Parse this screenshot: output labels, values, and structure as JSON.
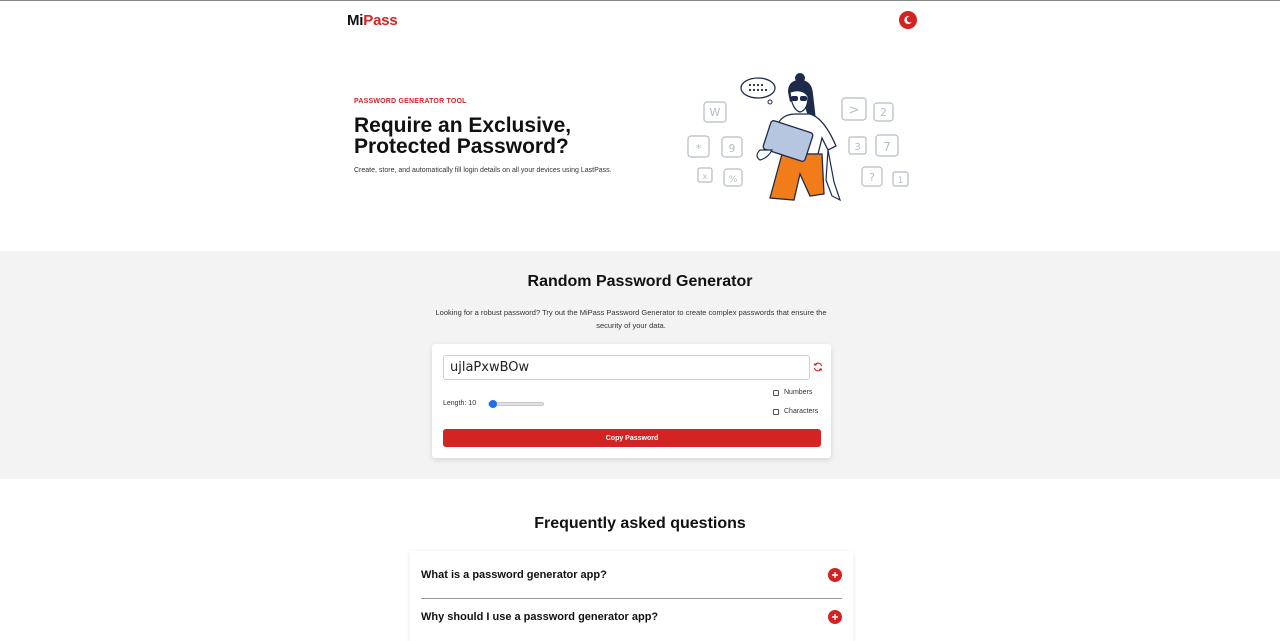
{
  "brand": {
    "mi": "Mi",
    "pass": "Pass",
    "accent": "#d42323"
  },
  "hero": {
    "eyebrow": "PASSWORD GENERATOR TOOL",
    "title_line1": "Require an Exclusive,",
    "title_line2": "Protected Password?",
    "subtitle": "Create, store, and automatically fill login details on all your devices using LastPass.",
    "illustration_keys": [
      "W",
      "*",
      "9",
      "x",
      "%",
      ">",
      "2",
      "3",
      "7",
      "?",
      "1"
    ]
  },
  "generator": {
    "title": "Random Password Generator",
    "description": "Looking for a robust password? Try out the MiPass Password Generator to create complex passwords that ensure the security of your data.",
    "password": "ujlaPxwBOw",
    "length_label": "Length: 10",
    "length_value": 10,
    "length_fraction": 0.04,
    "options": [
      {
        "label": "Numbers",
        "checked": false
      },
      {
        "label": "Characters",
        "checked": false
      }
    ],
    "copy_label": "Copy Password"
  },
  "faq": {
    "title": "Frequently asked questions",
    "items": [
      {
        "question": "What is a password generator app?"
      },
      {
        "question": "Why should I use a password generator app?"
      }
    ]
  }
}
